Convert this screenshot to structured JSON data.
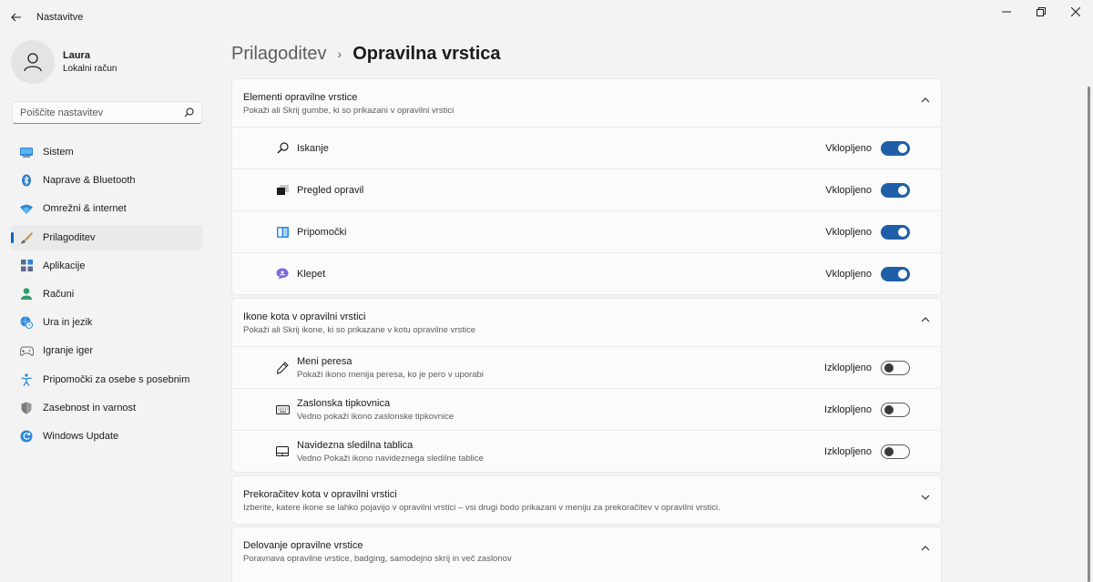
{
  "window": {
    "title": "Nastavitve"
  },
  "user": {
    "name": "Laura",
    "account": "Lokalni račun"
  },
  "search": {
    "placeholder": "Poiščite nastavitev"
  },
  "nav": {
    "items": [
      {
        "label": "Sistem",
        "icon": "monitor-icon"
      },
      {
        "label": "Naprave & Bluetooth",
        "icon": "bluetooth-icon"
      },
      {
        "label": "Omrežni & internet",
        "icon": "wifi-icon"
      },
      {
        "label": "Prilagoditev",
        "icon": "brush-icon",
        "active": true
      },
      {
        "label": "Aplikacije",
        "icon": "apps-icon"
      },
      {
        "label": "Računi",
        "icon": "person-icon"
      },
      {
        "label": "Ura in jezik",
        "icon": "globe-clock-icon"
      },
      {
        "label": "Igranje iger",
        "icon": "gamepad-icon"
      },
      {
        "label": "Pripomočki za osebe s posebnim",
        "icon": "accessibility-icon"
      },
      {
        "label": "Zasebnost in varnost",
        "icon": "shield-icon"
      },
      {
        "label": "Windows Update",
        "icon": "update-icon"
      }
    ]
  },
  "breadcrumb": {
    "parent": "Prilagoditev",
    "separator": "›",
    "current": "Opravilna vrstica"
  },
  "sections": {
    "elements": {
      "title": "Elementi opravilne vrstice",
      "subtitle": "Pokaži ali Skrij gumbe, ki so prikazani v opravilni vrstici",
      "expanded": true,
      "rows": [
        {
          "label": "Iskanje",
          "icon": "search-icon",
          "state": "Vklopljeno",
          "on": true
        },
        {
          "label": "Pregled opravil",
          "icon": "task-view-icon",
          "state": "Vklopljeno",
          "on": true
        },
        {
          "label": "Pripomočki",
          "icon": "widgets-icon",
          "state": "Vklopljeno",
          "on": true
        },
        {
          "label": "Klepet",
          "icon": "chat-icon",
          "state": "Vklopljeno",
          "on": true
        }
      ]
    },
    "corner_icons": {
      "title": "Ikone kota v opravilni vrstici",
      "subtitle": "Pokaži ali Skrij ikone, ki so prikazane v kotu opravilne vrstice",
      "expanded": true,
      "rows": [
        {
          "label": "Meni peresa",
          "desc": "Pokaži ikono menija peresa, ko je pero v uporabi",
          "icon": "pen-icon",
          "state": "Izklopljeno",
          "on": false
        },
        {
          "label": "Zaslonska tipkovnica",
          "desc": "Vedno pokaži ikono zaslonske tipkovnice",
          "icon": "keyboard-icon",
          "state": "Izklopljeno",
          "on": false
        },
        {
          "label": "Navidezna sledilna tablica",
          "desc": "Vedno Pokaži ikono navideznega sledilne tablice",
          "icon": "touchpad-icon",
          "state": "Izklopljeno",
          "on": false
        }
      ]
    },
    "overflow": {
      "title": "Prekoračitev kota v opravilni vrstici",
      "subtitle": "Izberite, katere ikone se lahko pojavijo v opravilni vrstici – vsi drugi bodo prikazani v meniju za prekoračitev v opravilni vrstici.",
      "expanded": false
    },
    "behavior": {
      "title": "Delovanje opravilne vrstice",
      "subtitle": "Poravnava opravilne vrstice, badging, samodejno skrij in več zaslonov",
      "expanded": true
    }
  },
  "colors": {
    "accent": "#0067c0",
    "toggle_on": "#1f5fa8"
  }
}
